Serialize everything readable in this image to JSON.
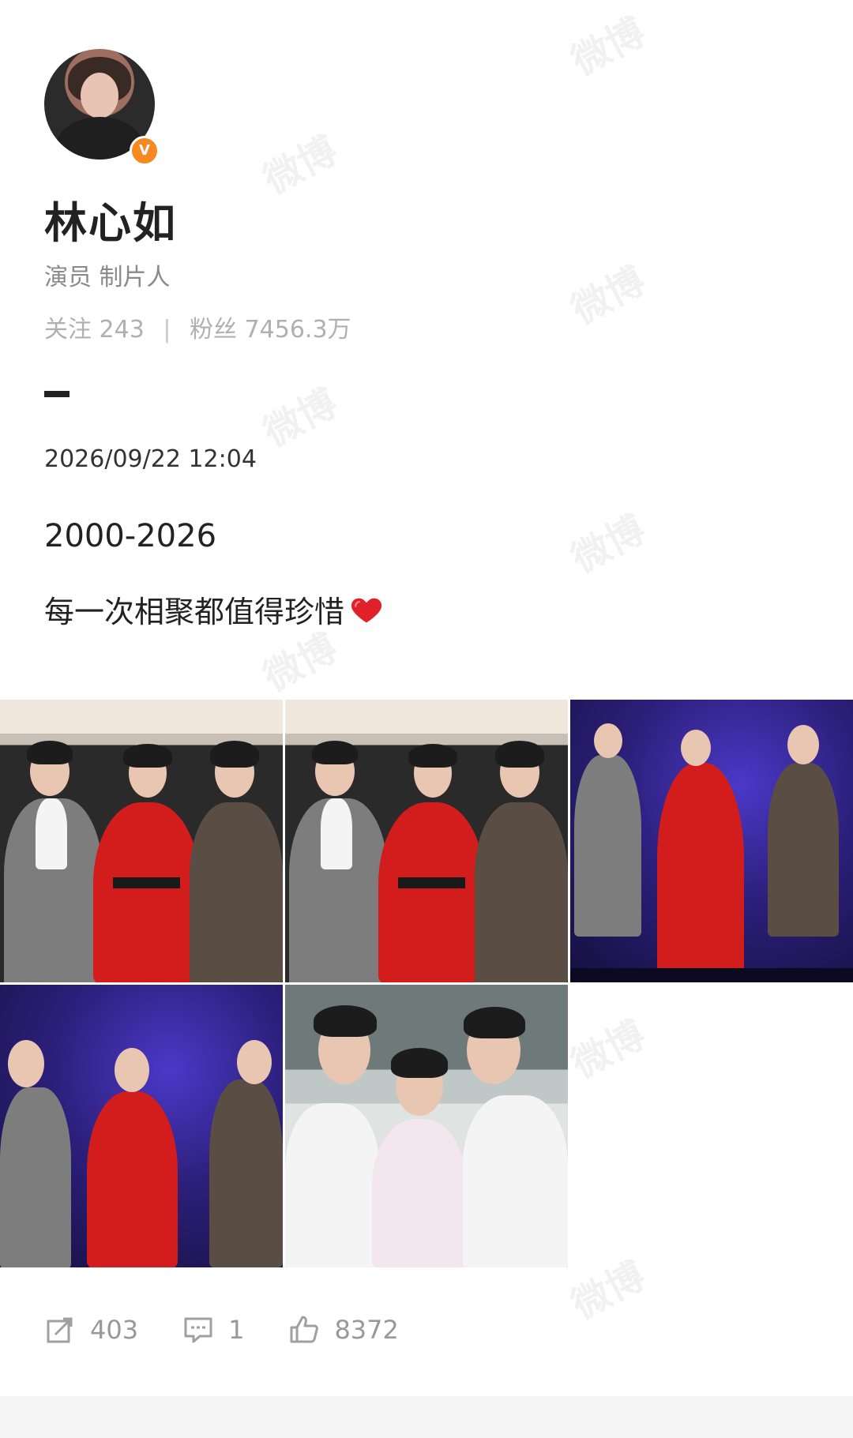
{
  "profile": {
    "name": "林心如",
    "bio": "演员 制片人",
    "following_label": "关注",
    "following_count": "243",
    "followers_label": "粉丝",
    "followers_count": "7456.3万",
    "verified_badge": "V"
  },
  "post": {
    "timestamp": "2026/09/22 12:04",
    "line1": "2000-2026",
    "line2": "每一次相聚都值得珍惜",
    "emoji": "heart-icon"
  },
  "images": [
    {
      "id": "photo-1",
      "scene": "studio"
    },
    {
      "id": "photo-2",
      "scene": "studio"
    },
    {
      "id": "photo-3",
      "scene": "stage"
    },
    {
      "id": "photo-4",
      "scene": "stage"
    },
    {
      "id": "photo-5",
      "scene": "old-photo"
    }
  ],
  "actions": {
    "repost_count": "403",
    "comment_count": "1",
    "like_count": "8372"
  },
  "watermark_text": "微博",
  "colors": {
    "verified": "#f6891f",
    "heart": "#e0202a"
  }
}
